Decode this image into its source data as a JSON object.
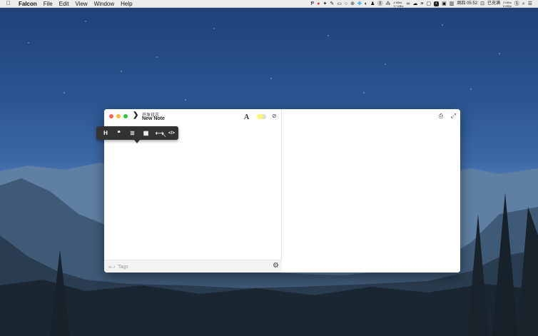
{
  "menubar": {
    "apple_icon": "apple-icon",
    "app_name": "Falcon",
    "items": [
      "File",
      "Edit",
      "View",
      "Window",
      "Help"
    ],
    "status": {
      "network_up": "4 KB/s",
      "network_down": "17 KB/s",
      "time": "周四 05:52",
      "charging": "已充满",
      "stats_top": "2 KB/s",
      "stats_bottom": "0 KB/s"
    }
  },
  "window": {
    "notebook": "开发日志",
    "title": "New Note",
    "toolbar": {
      "font_label": "A",
      "color_toggle_colors": [
        "#fff47a",
        "#b8dbff"
      ]
    },
    "format_toolbar": {
      "tools": [
        {
          "name": "heading",
          "glyph": "H"
        },
        {
          "name": "quote",
          "glyph": "❝"
        },
        {
          "name": "list",
          "glyph": "≣"
        },
        {
          "name": "table",
          "glyph": "▦"
        },
        {
          "name": "horizontal-rule",
          "glyph": "⟷"
        },
        {
          "name": "code",
          "glyph": "</>"
        }
      ]
    },
    "footer": {
      "tags_placeholder": "Tags"
    }
  },
  "colors": {
    "traffic_close": "#fd5f57",
    "traffic_min": "#febd2e",
    "traffic_max": "#28c840",
    "toolbar_bg": "#333333"
  }
}
